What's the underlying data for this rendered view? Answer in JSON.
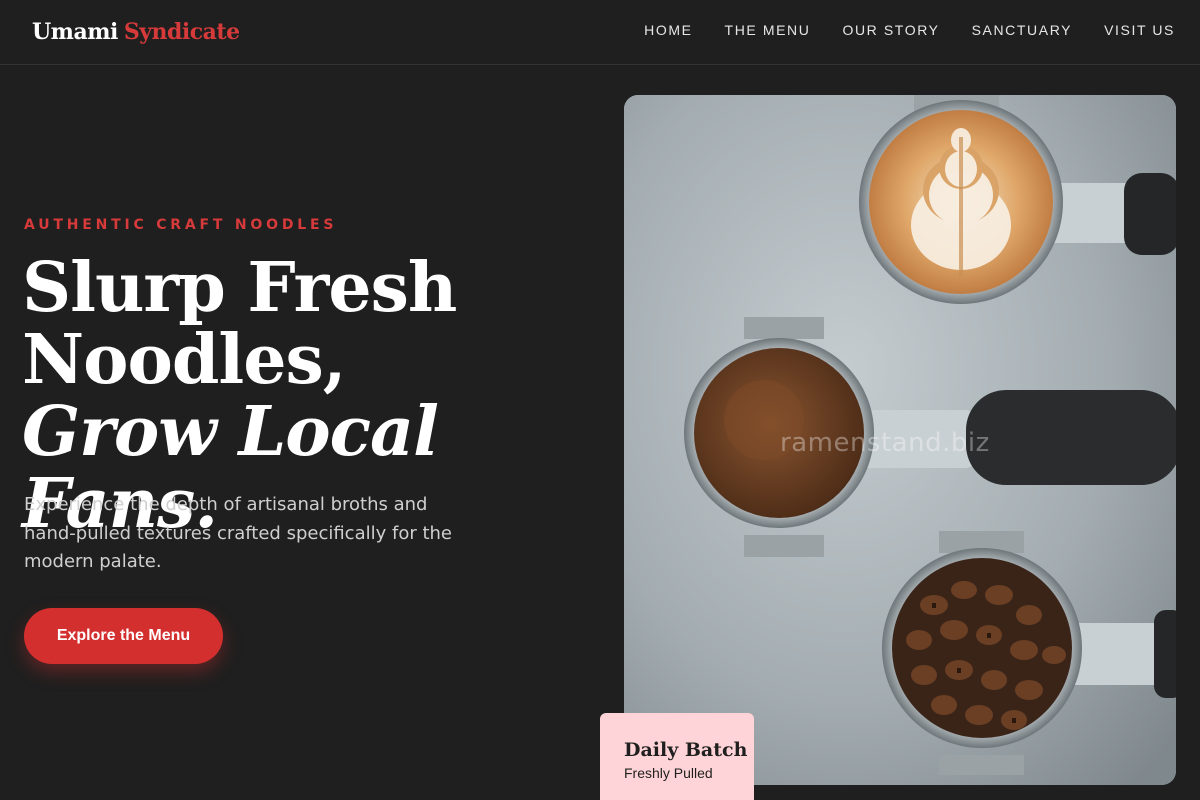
{
  "brand": {
    "part1": "Umami",
    "part2": "Syndicate"
  },
  "nav": [
    {
      "label": "HOME"
    },
    {
      "label": "THE MENU"
    },
    {
      "label": "OUR STORY"
    },
    {
      "label": "SANCTUARY"
    },
    {
      "label": "VISIT US"
    }
  ],
  "hero": {
    "eyebrow": "AUTHENTIC CRAFT NOODLES",
    "headline_line1": "Slurp Fresh",
    "headline_line2": "Noodles,",
    "headline_line3": "Grow Local Fans.",
    "description": "Experience the depth of artisanal broths and hand-pulled textures crafted specifically for the modern palate.",
    "cta_label": "Explore the Menu"
  },
  "image": {
    "watermark": "ramenstand.biz"
  },
  "badge": {
    "title": "Daily Batch",
    "subtitle": "Freshly Pulled"
  },
  "colors": {
    "background": "#1f1f1f",
    "accent": "#d63a3a",
    "badge": "#ffd4d8"
  },
  "icons": [
    "portafilter-latte-art",
    "portafilter-ground-coffee",
    "portafilter-coffee-beans"
  ]
}
